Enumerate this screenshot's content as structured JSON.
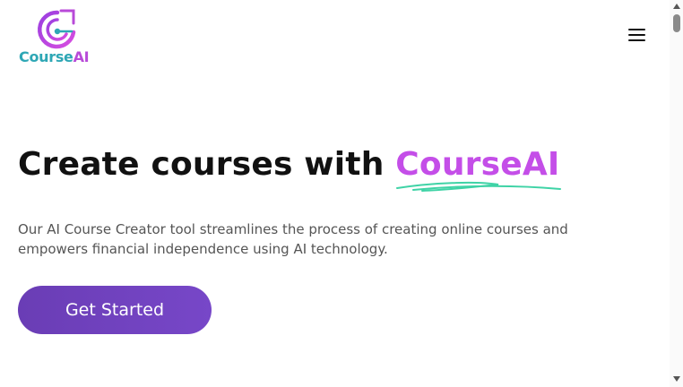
{
  "brand": {
    "name_part1": "Course",
    "name_part2": "AI",
    "color_primary": "#2ea7b5",
    "color_accent": "#b84ad8"
  },
  "nav": {
    "menu_icon": "hamburger-menu-icon"
  },
  "hero": {
    "headline_prefix": "Create courses with ",
    "headline_accent": "CourseAI",
    "description": "Our AI Course Creator tool streamlines the process of creating online courses and empowers financial independence using AI technology.",
    "cta_label": "Get Started",
    "accent_color": "#c44ee8",
    "underline_color": "#3fd3a6",
    "cta_color": "#6a3db5"
  }
}
